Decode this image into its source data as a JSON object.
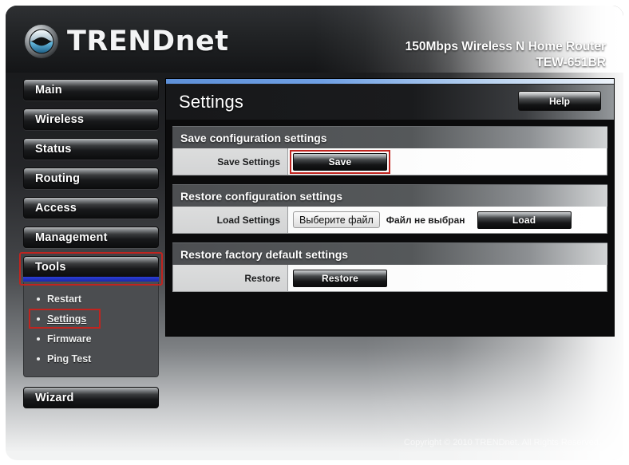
{
  "header": {
    "brand_name": "TRENDnet",
    "brand_logo_icon": "trendnet-wave-logo-icon",
    "product_line1": "150Mbps Wireless N Home Router",
    "product_line2": "TEW-651BR"
  },
  "colors": {
    "accent_blue": "#2b3fd6",
    "panel_top_blue": "#6fa0e4",
    "highlight_red": "#c0241f",
    "shell_dark": "#1c1d1f",
    "submenu_bg": "#4b4d50"
  },
  "sidebar": {
    "items": [
      {
        "label": "Main",
        "active": false,
        "highlighted": false
      },
      {
        "label": "Wireless",
        "active": false,
        "highlighted": false
      },
      {
        "label": "Status",
        "active": false,
        "highlighted": false
      },
      {
        "label": "Routing",
        "active": false,
        "highlighted": false
      },
      {
        "label": "Access",
        "active": false,
        "highlighted": false
      },
      {
        "label": "Management",
        "active": false,
        "highlighted": false
      },
      {
        "label": "Tools",
        "active": true,
        "highlighted": true
      }
    ],
    "submenu": [
      {
        "label": "Restart",
        "selected": false,
        "highlighted": false
      },
      {
        "label": "Settings",
        "selected": true,
        "highlighted": true
      },
      {
        "label": "Firmware",
        "selected": false,
        "highlighted": false
      },
      {
        "label": "Ping Test",
        "selected": false,
        "highlighted": false
      }
    ],
    "wizard": {
      "label": "Wizard"
    }
  },
  "main": {
    "page_title": "Settings",
    "help_label": "Help",
    "sections": [
      {
        "title": "Save configuration settings",
        "row_label": "Save Settings",
        "button_label": "Save",
        "button_highlighted": true
      },
      {
        "title": "Restore configuration settings",
        "row_label": "Load Settings",
        "file_choose_label": "Выберите файл",
        "file_status": "Файл не выбран",
        "button_label": "Load",
        "button_highlighted": false
      },
      {
        "title": "Restore factory default settings",
        "row_label": "Restore",
        "button_label": "Restore",
        "button_highlighted": false
      }
    ]
  },
  "footer": {
    "copyright": "Copyright © 2010 TRENDnet. All Rights Reserved."
  }
}
